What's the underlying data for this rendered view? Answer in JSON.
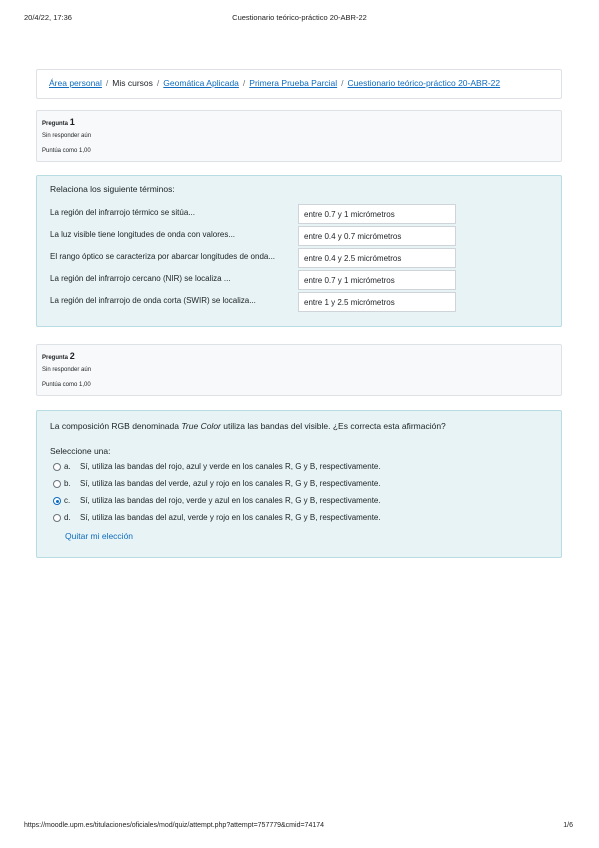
{
  "print": {
    "datetime": "20/4/22, 17:36",
    "doc_title": "Cuestionario teórico-práctico 20-ABR-22",
    "url": "https://moodle.upm.es/titulaciones/oficiales/mod/quiz/attempt.php?attempt=757779&cmid=74174",
    "page": "1/6"
  },
  "breadcrumb": {
    "items": [
      {
        "label": "Área personal",
        "link": true
      },
      {
        "label": "Mis cursos",
        "link": false
      },
      {
        "label": "Geomática Aplicada",
        "link": true
      },
      {
        "label": "Primera Prueba Parcial",
        "link": true
      },
      {
        "label": "Cuestionario teórico-práctico 20-ABR-22",
        "link": true
      }
    ],
    "separator": "/"
  },
  "q1": {
    "label": "Pregunta",
    "number": "1",
    "status": "Sin responder aún",
    "grade": "Puntúa como 1,00",
    "text": "Relaciona los siguiente términos:",
    "rows": [
      {
        "term": "La región del infrarrojo térmico se sitúa...",
        "answer": "entre 0.7 y 1 micrómetros"
      },
      {
        "term": "La luz visible tiene longitudes de onda con valores...",
        "answer": "entre 0.4 y 0.7 micrómetros"
      },
      {
        "term": "El rango óptico se caracteriza por abarcar longitudes de onda...",
        "answer": "entre 0.4 y 2.5 micrómetros"
      },
      {
        "term": "La región del infrarrojo cercano (NIR) se localiza ...",
        "answer": "entre 0.7 y 1 micrómetros"
      },
      {
        "term": "La región del infrarrojo de onda corta (SWIR) se localiza...",
        "answer": "entre 1 y 2.5 micrómetros"
      }
    ]
  },
  "q2": {
    "label": "Pregunta",
    "number": "2",
    "status": "Sin responder aún",
    "grade": "Puntúa como 1,00",
    "text_before": "La composición RGB denominada ",
    "text_italic": "True Color",
    "text_after": " utiliza las bandas del visible. ¿Es correcta esta afirmación?",
    "choose_label": "Seleccione una:",
    "options": [
      {
        "letter": "a.",
        "text": "Sí, utiliza las bandas del rojo, azul y verde en los canales R, G y B, respectivamente.",
        "checked": false
      },
      {
        "letter": "b.",
        "text": "Sí, utiliza las bandas del verde, azul y rojo en los canales R, G y B, respectivamente.",
        "checked": false
      },
      {
        "letter": "c.",
        "text": "Sí, utiliza las bandas del rojo, verde y azul en los canales R, G y B, respectivamente.",
        "checked": true
      },
      {
        "letter": "d.",
        "text": "Sí, utiliza las bandas del azul, verde y rojo en los canales R, G y B, respectivamente.",
        "checked": false
      }
    ],
    "clear_label": "Quitar mi elección"
  },
  "colors": {
    "link": "#0f6cbf",
    "content_bg": "#e7f3f5",
    "info_bg": "#f8f9fa"
  }
}
